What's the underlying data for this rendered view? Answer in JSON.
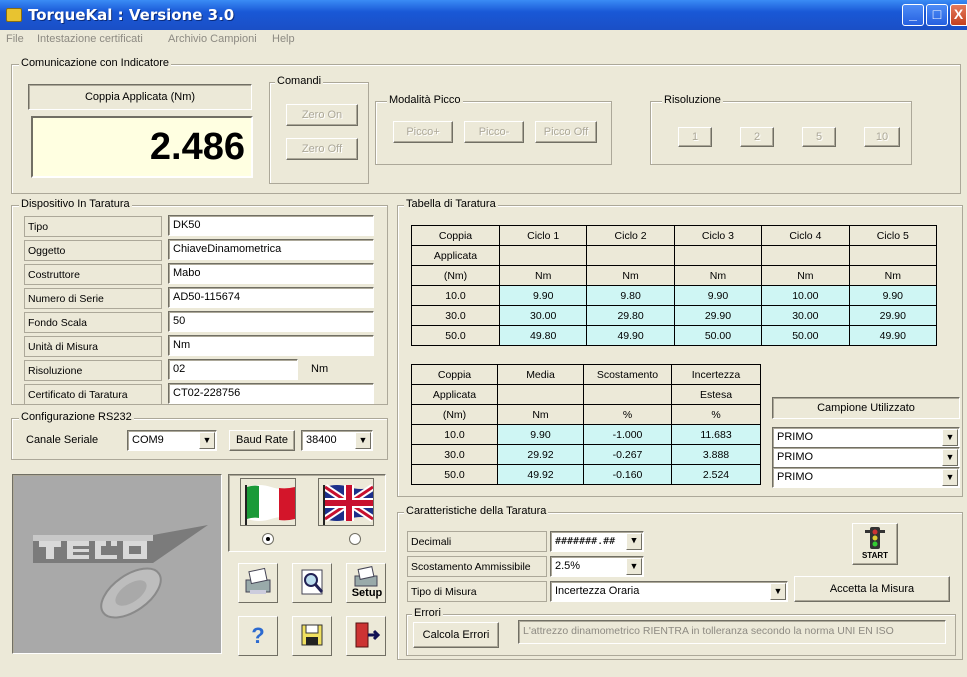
{
  "window": {
    "title": "TorqueKal : Versione 3.0",
    "minimize": "_",
    "maximize": "□",
    "close": "X"
  },
  "menu": [
    "File",
    "Intestazione certificati",
    "Archivio Campioni",
    "Help"
  ],
  "comunicazione": {
    "group_label": "Comunicazione con Indicatore",
    "coppia_label": "Coppia Applicata (Nm)",
    "coppia_value": "2.486",
    "comandi_label": "Comandi",
    "zero_on": "Zero On",
    "zero_off": "Zero Off",
    "picco_label": "Modalità Picco",
    "picco_plus": "Picco+",
    "picco_minus": "Picco-",
    "picco_off": "Picco Off",
    "risoluzione_label": "Risoluzione",
    "ris_buttons": [
      "1",
      "2",
      "5",
      "10"
    ]
  },
  "dispositivo": {
    "group_label": "Dispositivo In Taratura",
    "fields": [
      {
        "label": "Tipo",
        "value": "DK50"
      },
      {
        "label": "Oggetto",
        "value": "ChiaveDinamometrica"
      },
      {
        "label": "Costruttore",
        "value": "Mabo"
      },
      {
        "label": "Numero di Serie",
        "value": "AD50-115674"
      },
      {
        "label": "Fondo Scala",
        "value": "50"
      },
      {
        "label": "Unità di Misura",
        "value": "Nm"
      },
      {
        "label": "Risoluzione",
        "value": "02"
      },
      {
        "label": "Certificato di Taratura",
        "value": "CT02-228756"
      }
    ],
    "risoluzione_unit": "Nm"
  },
  "rs232": {
    "group_label": "Configurazione RS232",
    "canale_label": "Canale Seriale",
    "canale_value": "COM9",
    "baud_label": "Baud Rate",
    "baud_value": "38400"
  },
  "tabella": {
    "group_label": "Tabella di Taratura",
    "header": [
      "Coppia",
      "Ciclo 1",
      "Ciclo 2",
      "Ciclo 3",
      "Ciclo 4",
      "Ciclo 5"
    ],
    "header2": "Applicata",
    "units": [
      "(Nm)",
      "Nm",
      "Nm",
      "Nm",
      "Nm",
      "Nm"
    ],
    "rows": [
      [
        "10.0",
        "9.90",
        "9.80",
        "9.90",
        "10.00",
        "9.90"
      ],
      [
        "30.0",
        "30.00",
        "29.80",
        "29.90",
        "30.00",
        "29.90"
      ],
      [
        "50.0",
        "49.80",
        "49.90",
        "50.00",
        "50.00",
        "49.90"
      ]
    ]
  },
  "risultati": {
    "header": [
      "Coppia",
      "Media",
      "Scostamento",
      "Incertezza"
    ],
    "header2": [
      "Applicata",
      "",
      "",
      "Estesa"
    ],
    "units": [
      "(Nm)",
      "Nm",
      "%",
      "%"
    ],
    "rows": [
      [
        "10.0",
        "9.90",
        "-1.000",
        "11.683"
      ],
      [
        "30.0",
        "29.92",
        "-0.267",
        "3.888"
      ],
      [
        "50.0",
        "49.92",
        "-0.160",
        "2.524"
      ]
    ],
    "campione_header": "Campione Utilizzato",
    "campioni": [
      "PRIMO",
      "PRIMO",
      "PRIMO"
    ]
  },
  "caratteristiche": {
    "group_label": "Caratteristiche della Taratura",
    "decimali_label": "Decimali",
    "decimali_value": "#######.##",
    "scostamento_label": "Scostamento Ammissibile",
    "scostamento_value": "2.5%",
    "tipo_label": "Tipo di Misura",
    "tipo_value": "Incertezza Oraria",
    "start_label": "START",
    "accetta_label": "Accetta la Misura",
    "errori_label": "Errori",
    "calcola_label": "Calcola Errori",
    "messaggio": "L'attrezzo dinamometrico RIENTRA in tolleranza secondo la norma UNI EN ISO"
  },
  "tools": {
    "setup_label": "Setup",
    "help_glyph": "?"
  },
  "colors": {
    "cell_value": "#cff6f4",
    "readout_bg": "#ffffe1",
    "title_blue": "#1958d6"
  }
}
